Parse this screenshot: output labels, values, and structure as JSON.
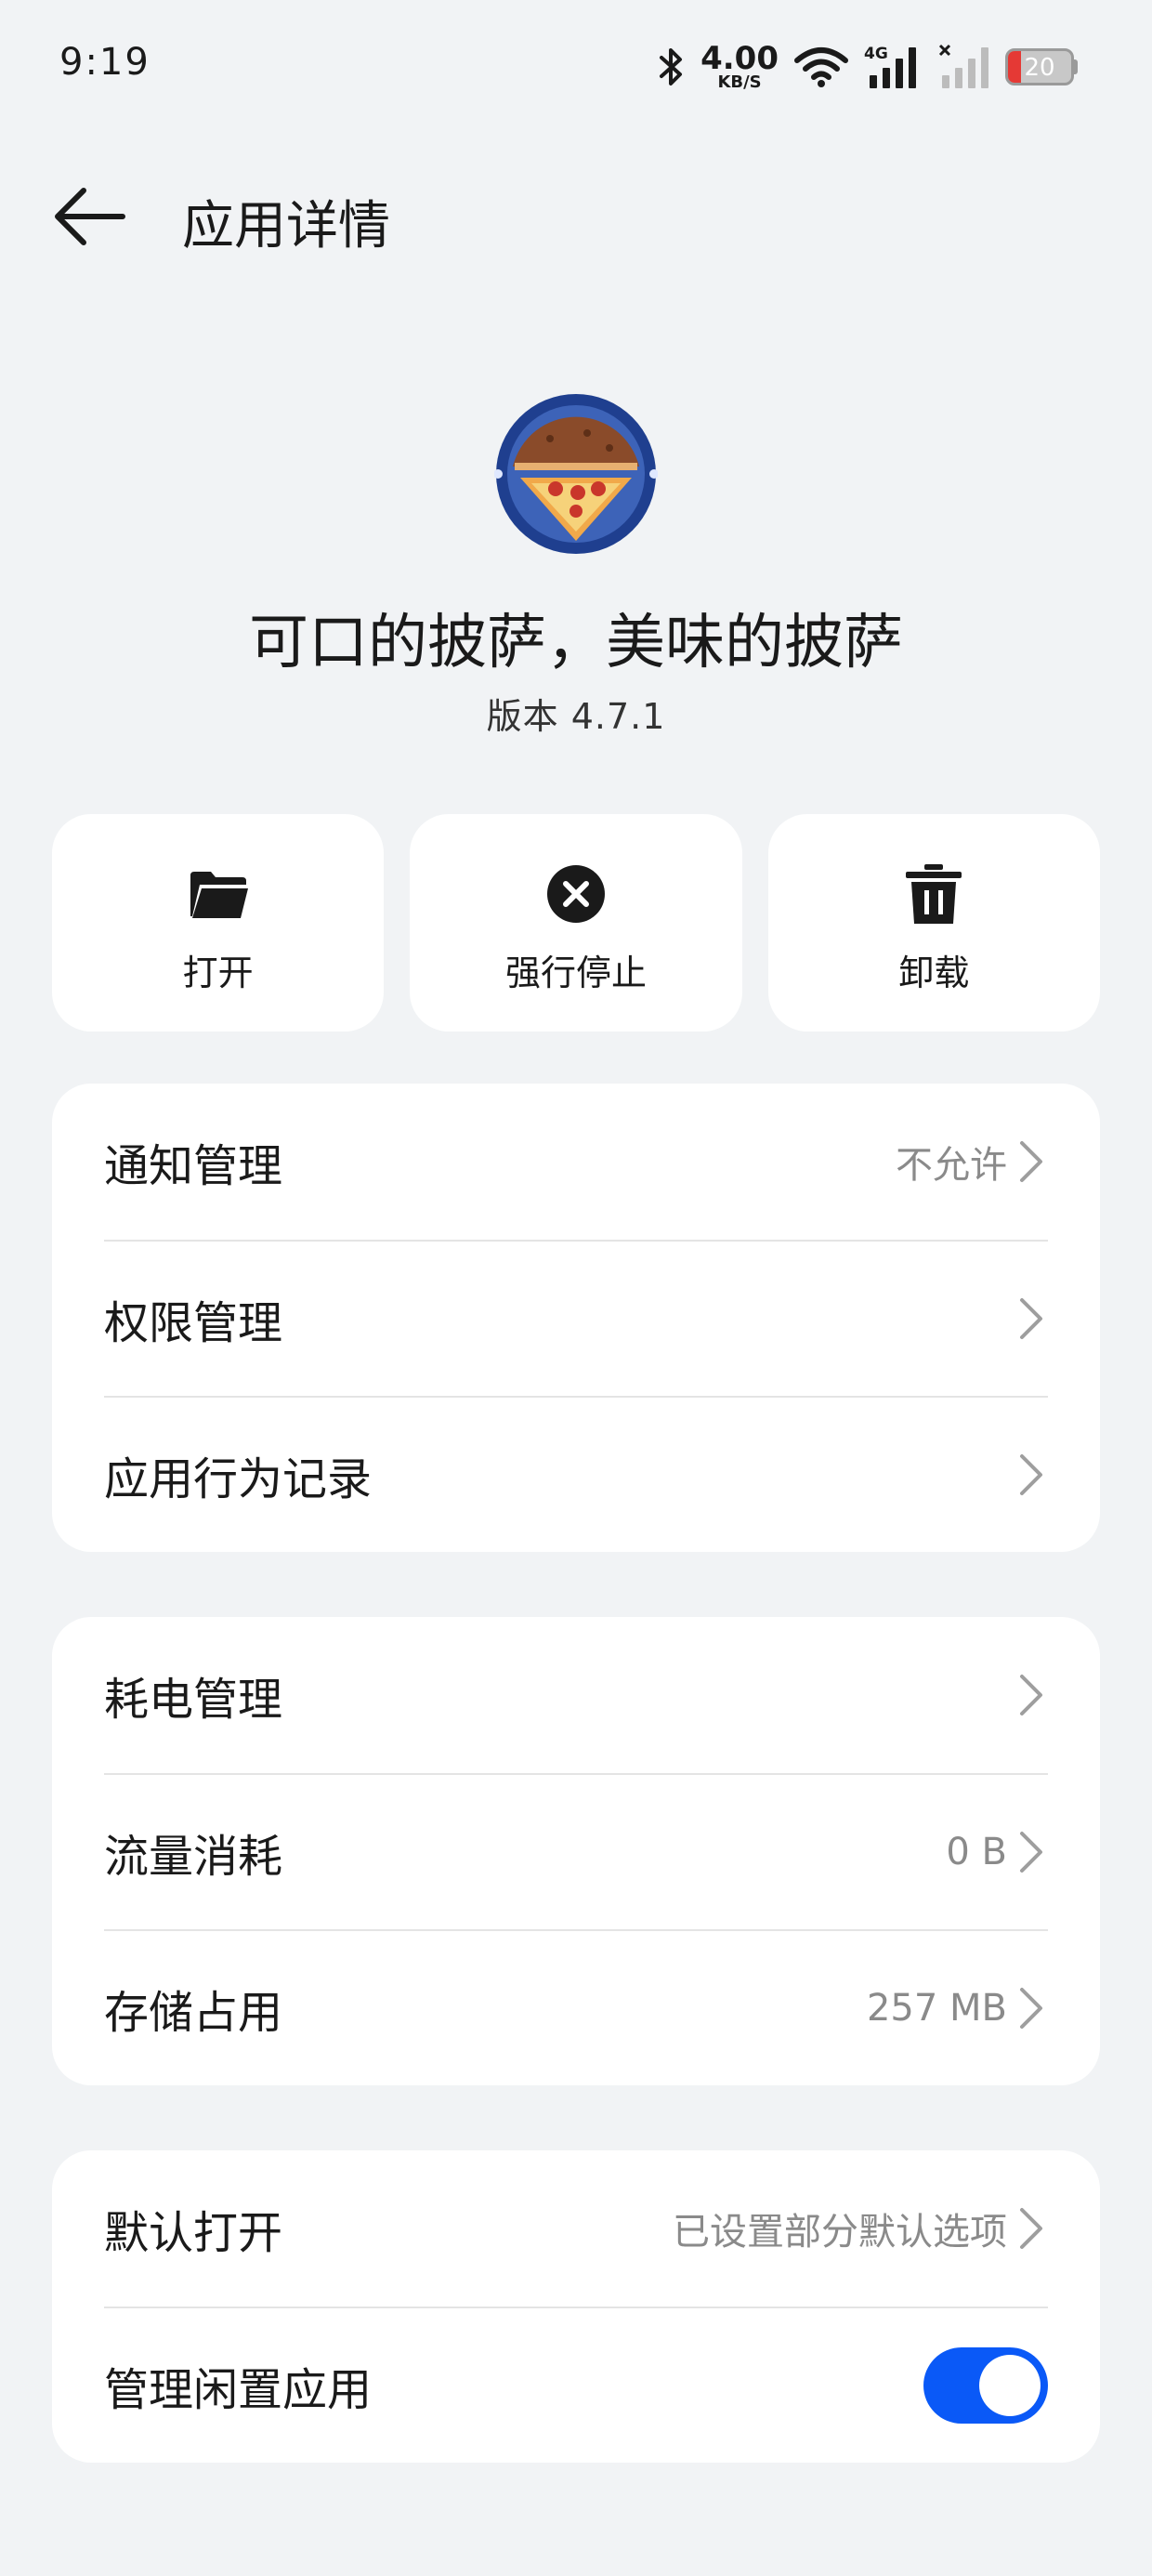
{
  "status_bar": {
    "time": "9:19",
    "net_speed": "4.00",
    "net_unit": "KB/S",
    "network_type": "4G",
    "battery": "20",
    "battery_level": 0.2,
    "icons": [
      "bluetooth-icon",
      "wifi-icon",
      "signal-4g-icon",
      "signal-no-sim-icon",
      "battery-icon"
    ]
  },
  "header": {
    "title": "应用详情"
  },
  "app": {
    "name": "可口的披萨，美味的披萨",
    "version": "版本 4.7.1",
    "icon": "pizza-app-icon"
  },
  "actions": [
    {
      "label": "打开",
      "icon": "folder-icon"
    },
    {
      "label": "强行停止",
      "icon": "force-stop-icon"
    },
    {
      "label": "卸载",
      "icon": "trash-icon"
    }
  ],
  "group1": [
    {
      "label": "通知管理",
      "value": "不允许"
    },
    {
      "label": "权限管理",
      "value": ""
    },
    {
      "label": "应用行为记录",
      "value": ""
    }
  ],
  "group2": [
    {
      "label": "耗电管理",
      "value": ""
    },
    {
      "label": "流量消耗",
      "value": "0 B"
    },
    {
      "label": "存储占用",
      "value": "257 MB"
    }
  ],
  "group3": [
    {
      "label": "默认打开",
      "value": "已设置部分默认选项"
    },
    {
      "label": "管理闲置应用",
      "toggle_on": true
    }
  ],
  "colors": {
    "background": "#f1f3f5",
    "card": "#ffffff",
    "accent": "#0a59f7",
    "battery_low": "#e53935",
    "secondary_text": "#8a8a8a"
  }
}
